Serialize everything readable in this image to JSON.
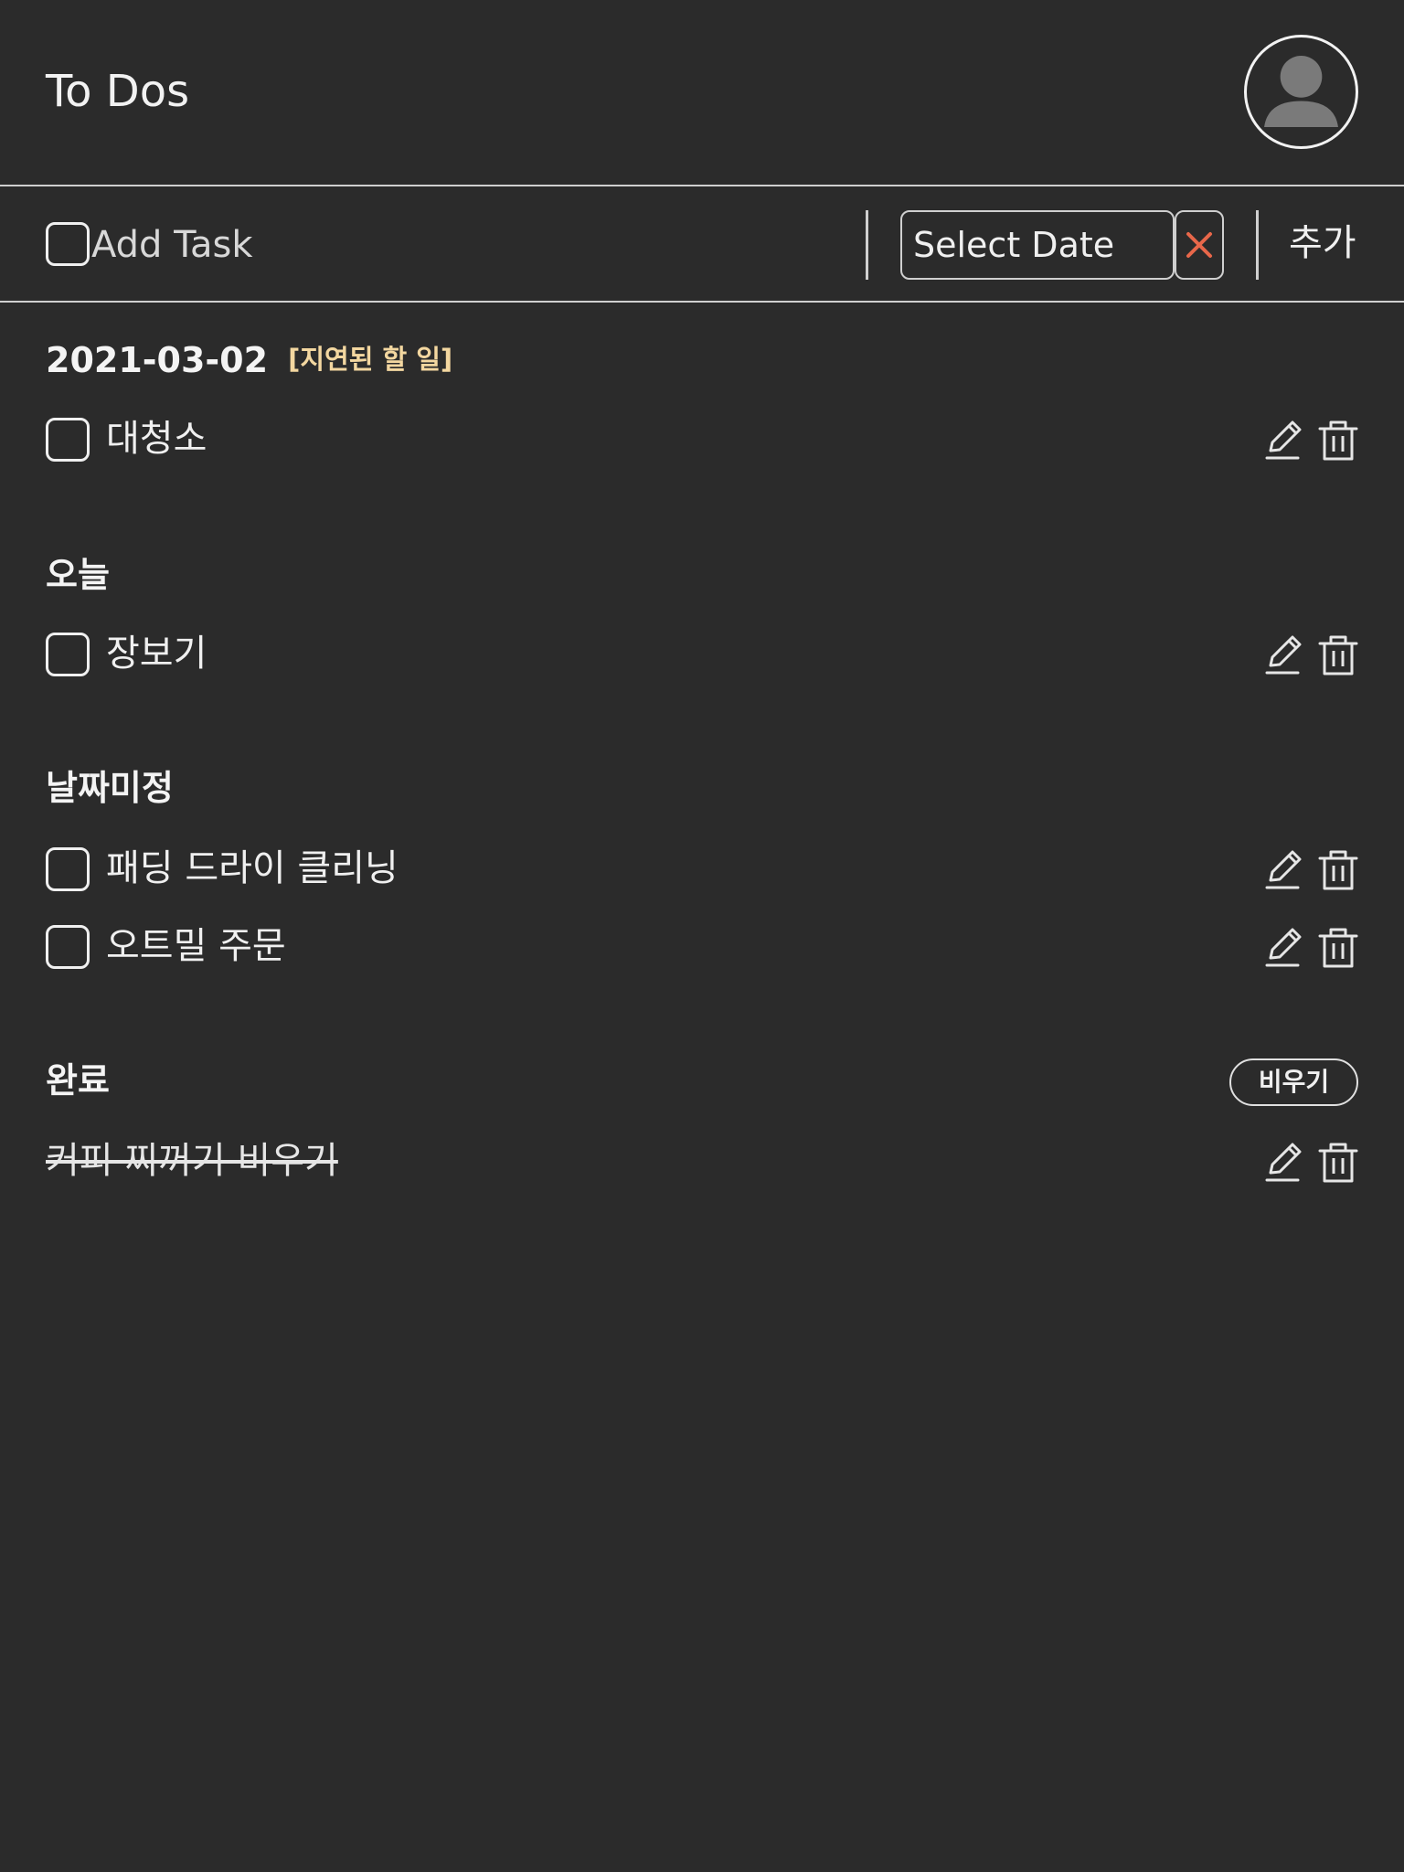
{
  "header": {
    "title": "To Dos"
  },
  "add_bar": {
    "placeholder": "Add Task",
    "date_placeholder": "Select Date",
    "submit_label": "추가"
  },
  "sections": {
    "overdue": {
      "date": "2021-03-02",
      "tag": "[지연된 할 일]",
      "tasks": [
        "대청소"
      ]
    },
    "today": {
      "title": "오늘",
      "tasks": [
        "장보기"
      ]
    },
    "no_date": {
      "title": "날짜미정",
      "tasks": [
        "패딩 드라이 클리닝",
        "오트밀 주문"
      ]
    },
    "completed": {
      "title": "완료",
      "clear_label": "비우기",
      "tasks": [
        "커피 찌꺼기 비우기"
      ]
    }
  },
  "icons": {
    "avatar": "user-avatar-icon",
    "clear_date": "close-icon",
    "edit": "pencil-icon",
    "delete": "trash-icon"
  },
  "colors": {
    "background": "#2b2b2b",
    "text": "#f0f0f0",
    "overdue_tag": "#f3d7a0",
    "clear_x": "#e8674a"
  }
}
